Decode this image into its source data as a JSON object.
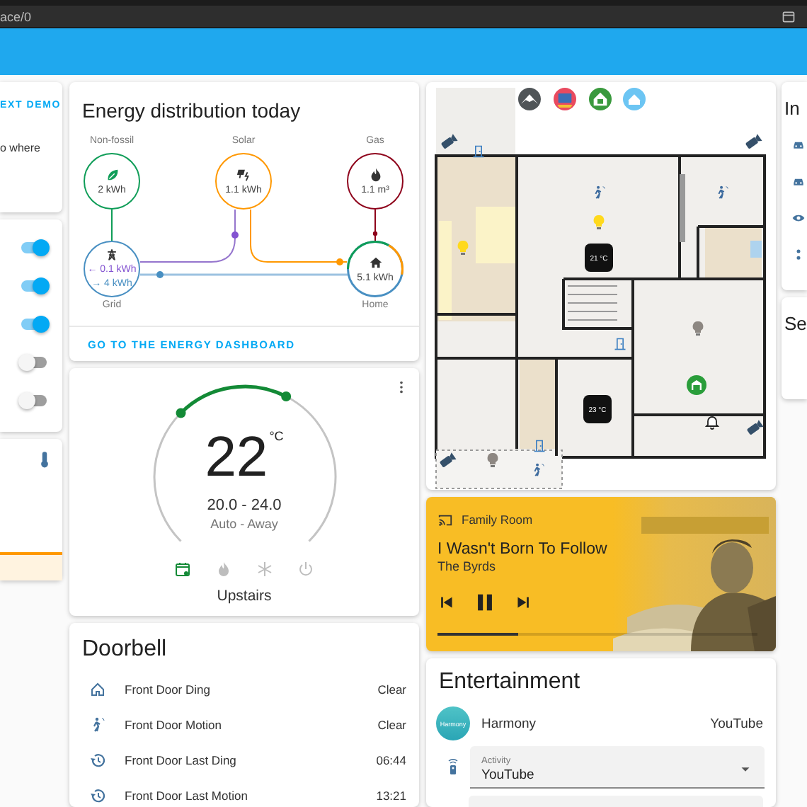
{
  "browser": {
    "address": "ace/0"
  },
  "left_column": {
    "demo_link": "EXT DEMO",
    "demo_text": "o where",
    "toggles": [
      {
        "on": true
      },
      {
        "on": true
      },
      {
        "on": true
      },
      {
        "on": false
      },
      {
        "on": false
      }
    ]
  },
  "energy": {
    "title": "Energy distribution today",
    "sources": [
      {
        "kind": "non_fossil",
        "label": "Non-fossil",
        "value": "2 kWh",
        "color": "#0f9d58"
      },
      {
        "kind": "solar",
        "label": "Solar",
        "value": "1.1 kWh",
        "color": "#ff9800"
      },
      {
        "kind": "gas",
        "label": "Gas",
        "value": "1.1 m³",
        "color": "#8e021b"
      }
    ],
    "grid": {
      "label": "Grid",
      "returned": "← 0.1 kWh",
      "consumed": "→ 4 kWh"
    },
    "home": {
      "label": "Home",
      "value": "5.1 kWh"
    },
    "link": "GO TO THE ENERGY DASHBOARD"
  },
  "thermostat": {
    "temperature": "22",
    "unit": "°C",
    "target": "20.0 - 24.0",
    "mode": "Auto - Away",
    "name": "Upstairs",
    "modes": [
      {
        "kind": "auto",
        "selected": true
      },
      {
        "kind": "heat",
        "selected": false
      },
      {
        "kind": "cool",
        "selected": false
      },
      {
        "kind": "off",
        "selected": false
      }
    ]
  },
  "doorbell": {
    "title": "Doorbell",
    "rows": [
      {
        "kind": "ding",
        "label": "Front Door Ding",
        "value": "Clear"
      },
      {
        "kind": "motion",
        "label": "Front Door Motion",
        "value": "Clear"
      },
      {
        "kind": "history",
        "label": "Front Door Last Ding",
        "value": "06:44"
      },
      {
        "kind": "history",
        "label": "Front Door Last Motion",
        "value": "13:21"
      }
    ]
  },
  "floorplan": {
    "thermostats": [
      "21 °C",
      "23 °C"
    ],
    "lights": [
      {
        "on": true
      },
      {
        "on": true
      },
      {
        "on": false
      },
      {
        "on": false
      }
    ]
  },
  "media": {
    "source": "Family Room",
    "title": "I Wasn't Born To Follow",
    "artist": "The Byrds",
    "playing": true,
    "level": 0.25
  },
  "entertainment": {
    "title": "Entertainment",
    "device": {
      "logo": "Harmony",
      "name": "Harmony",
      "state": "YouTube"
    },
    "activity": {
      "label": "Activity",
      "value": "YouTube"
    }
  },
  "right_column": {
    "cards": [
      {
        "title": "In"
      },
      {
        "title": "Se"
      }
    ]
  }
}
